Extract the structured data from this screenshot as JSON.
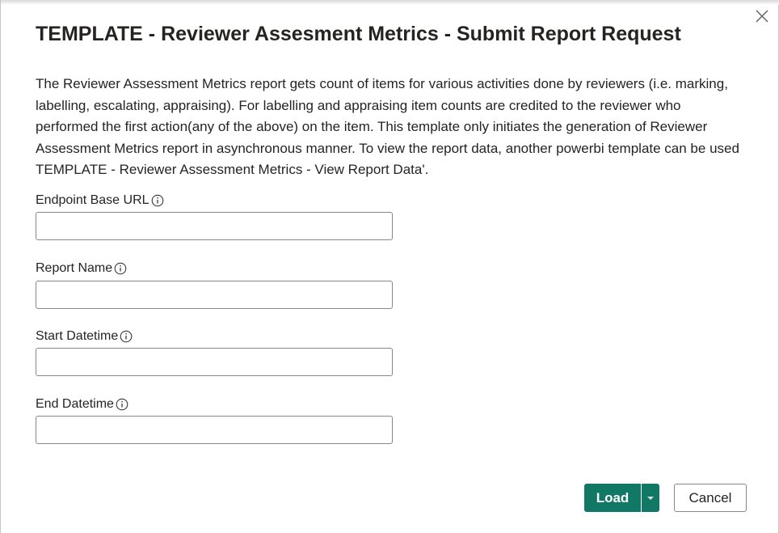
{
  "dialog": {
    "title": "TEMPLATE - Reviewer Assesment Metrics - Submit Report Request",
    "description": "The Reviewer Assessment Metrics report gets count of items for various activities done by reviewers (i.e. marking, labelling, escalating, appraising). For labelling and appraising item counts are credited to the reviewer who performed the first action(any of the above) on the item. This template only initiates the generation of Reviewer Assessment Metrics report in asynchronous manner. To view the report data, another powerbi template can be used TEMPLATE - Reviewer Assessment Metrics - View Report Data'.",
    "close_icon": "close-icon"
  },
  "fields": [
    {
      "label": "Endpoint Base URL",
      "value": "",
      "icon": "info-icon"
    },
    {
      "label": "Report Name",
      "value": "",
      "icon": "info-icon"
    },
    {
      "label": "Start Datetime",
      "value": "",
      "icon": "info-icon"
    },
    {
      "label": "End Datetime",
      "value": "",
      "icon": "info-icon"
    }
  ],
  "buttons": {
    "load_label": "Load",
    "load_dropdown_icon": "caret-down-icon",
    "cancel_label": "Cancel"
  },
  "colors": {
    "primary": "#117865",
    "text": "#252423",
    "border": "#8a8886"
  }
}
